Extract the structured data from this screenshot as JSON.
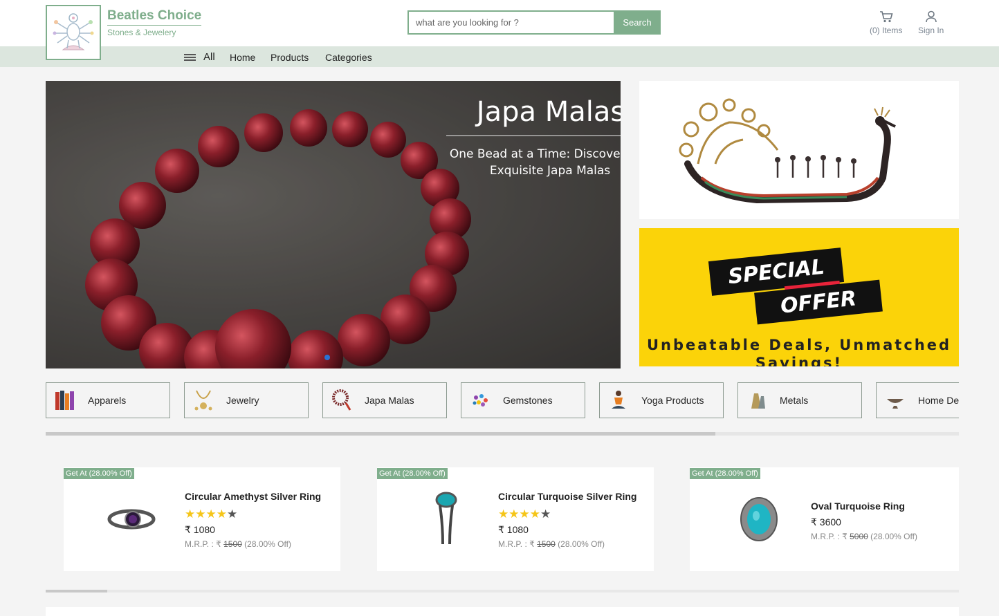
{
  "brand": {
    "name": "Beatles Choice",
    "tagline": "Stones & Jewelery"
  },
  "search": {
    "placeholder": "what are you looking for ?",
    "button": "Search"
  },
  "header": {
    "cart_label": "(0) Items",
    "signin_label": "Sign In"
  },
  "nav": {
    "all": "All",
    "links": [
      "Home",
      "Products",
      "Categories"
    ]
  },
  "hero": {
    "title": "Japa Malas",
    "subtitle": "One Bead at a Time: Discover Our Exquisite Japa Malas",
    "slide_index": 1
  },
  "promo": {
    "line1": "SPECIAL",
    "line2": "OFFER",
    "caption": "Unbeatable Deals, Unmatched Savings!"
  },
  "categories": [
    "Apparels",
    "Jewelry",
    "Japa Malas",
    "Gemstones",
    "Yoga Products",
    "Metals",
    "Home Decor"
  ],
  "products": [
    {
      "badge": "Get At (28.00% Off)",
      "name": "Circular Amethyst Silver Ring",
      "rating": 4.5,
      "price": "₹ 1080",
      "mrp_label": "M.R.P. : ₹",
      "mrp": "1500",
      "discount": "(28.00% Off)"
    },
    {
      "badge": "Get At (28.00% Off)",
      "name": "Circular Turquoise Silver Ring",
      "rating": 4.5,
      "price": "₹ 1080",
      "mrp_label": "M.R.P. : ₹",
      "mrp": "1500",
      "discount": "(28.00% Off)"
    },
    {
      "badge": "Get At (28.00% Off)",
      "name": "Oval Turquoise Ring",
      "rating": 0,
      "price": "₹ 3600",
      "mrp_label": "M.R.P. : ₹",
      "mrp": "5000",
      "discount": "(28.00% Off)"
    }
  ],
  "colors": {
    "brand_green": "#7fae8c",
    "nav_bg": "#dce6de",
    "promo_yellow": "#fbd309",
    "star": "#f5c518",
    "carousel_dot": "#2a72d4"
  },
  "icons": {
    "cart": "cart-icon",
    "user": "user-icon",
    "menu": "hamburger-icon"
  }
}
